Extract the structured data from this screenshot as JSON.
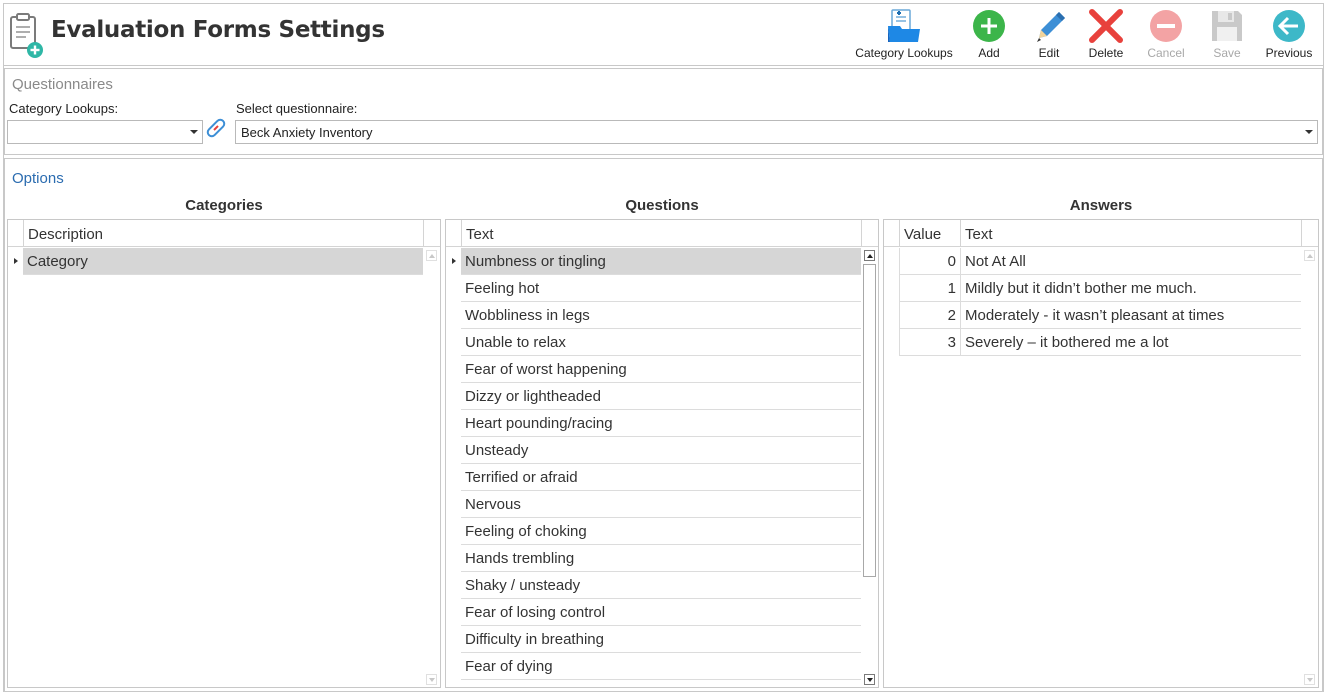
{
  "window": {
    "title": "Evaluation Forms Settings"
  },
  "toolbar": {
    "category_lookups": "Category Lookups",
    "add": "Add",
    "edit": "Edit",
    "delete": "Delete",
    "cancel": "Cancel",
    "save": "Save",
    "previous": "Previous"
  },
  "questionnaires": {
    "title": "Questionnaires",
    "category_lookups_label": "Category Lookups:",
    "category_lookups_value": "",
    "select_label": "Select questionnaire:",
    "select_value": "Beck Anxiety Inventory"
  },
  "options": {
    "title": "Options",
    "categories": {
      "title": "Categories",
      "header": "Description",
      "rows": [
        "Category"
      ]
    },
    "questions": {
      "title": "Questions",
      "header": "Text",
      "rows": [
        "Numbness or tingling",
        "Feeling hot",
        "Wobbliness in legs",
        "Unable to relax",
        "Fear of worst happening",
        "Dizzy or lightheaded",
        "Heart pounding/racing",
        "Unsteady",
        "Terrified or afraid",
        "Nervous",
        "Feeling of choking",
        "Hands trembling",
        "Shaky / unsteady",
        "Fear of losing control",
        "Difficulty in breathing",
        "Fear of dying"
      ]
    },
    "answers": {
      "title": "Answers",
      "header_value": "Value",
      "header_text": "Text",
      "rows": [
        {
          "value": "0",
          "text": "Not At All"
        },
        {
          "value": "1",
          "text": "Mildly but it didn’t bother me much."
        },
        {
          "value": "2",
          "text": "Moderately - it wasn’t pleasant at times"
        },
        {
          "value": "3",
          "text": "Severely – it bothered me a lot"
        }
      ]
    }
  },
  "colors": {
    "accent": "#2b6cb0",
    "add_green": "#3cb54a",
    "delete_red": "#e8413c",
    "previous_teal": "#3db8c8",
    "selection": "#d6d6d6"
  }
}
